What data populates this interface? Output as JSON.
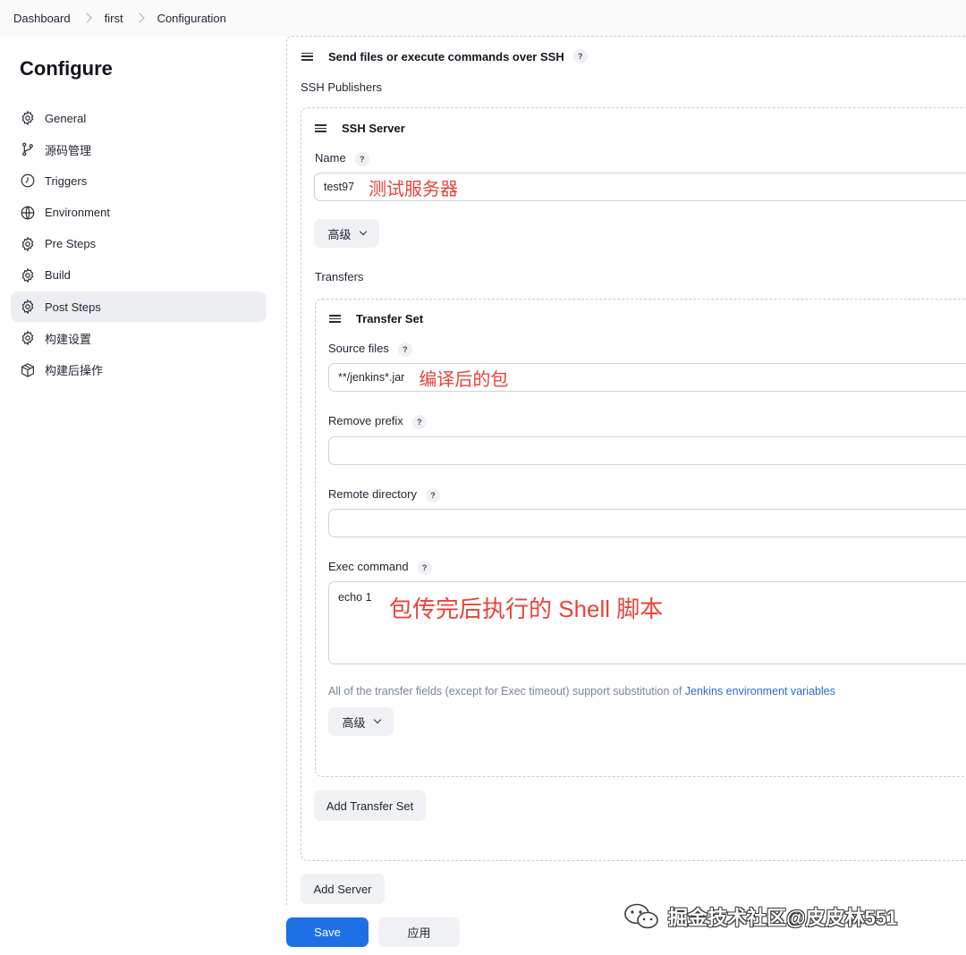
{
  "breadcrumb": {
    "items": [
      "Dashboard",
      "first",
      "Configuration"
    ]
  },
  "sidebar": {
    "title": "Configure",
    "items": [
      {
        "label": "General",
        "icon": "gear-icon"
      },
      {
        "label": "源码管理",
        "icon": "branch-icon"
      },
      {
        "label": "Triggers",
        "icon": "timer-icon"
      },
      {
        "label": "Environment",
        "icon": "globe-icon"
      },
      {
        "label": "Pre Steps",
        "icon": "gear-icon"
      },
      {
        "label": "Build",
        "icon": "gear-icon"
      },
      {
        "label": "Post Steps",
        "icon": "gear-icon",
        "active": true
      },
      {
        "label": "构建设置",
        "icon": "gear-icon"
      },
      {
        "label": "构建后操作",
        "icon": "package-icon"
      }
    ]
  },
  "main": {
    "section_title": "Send files or execute commands over SSH",
    "publishers_label": "SSH Publishers",
    "server": {
      "title": "SSH Server",
      "name_label": "Name",
      "name_value": "test97",
      "name_annotation": "测试服务器",
      "advanced_label": "高级",
      "transfers_label": "Transfers"
    },
    "transfer_set": {
      "title": "Transfer Set",
      "source_files_label": "Source files",
      "source_files_value": "**/jenkins*.jar",
      "source_files_annotation": "编译后的包",
      "remove_prefix_label": "Remove prefix",
      "remove_prefix_value": "",
      "remote_directory_label": "Remote directory",
      "remote_directory_value": "",
      "exec_command_label": "Exec command",
      "exec_command_value": "echo 1",
      "exec_command_annotation": "包传完后执行的 Shell 脚本",
      "hint_text": "All of the transfer fields (except for Exec timeout) support substitution of ",
      "hint_link": "Jenkins environment variables",
      "advanced_label": "高级"
    },
    "add_transfer_set_label": "Add Transfer Set",
    "add_server_label": "Add Server"
  },
  "footer": {
    "save_label": "Save",
    "apply_label": "应用"
  },
  "watermark": {
    "text": "掘金技术社区@皮皮林551"
  },
  "colors": {
    "primary": "#1e6fe6",
    "annotation": "#e8443a",
    "link": "#2b6bd1",
    "active_nav_bg": "#eceef2"
  }
}
